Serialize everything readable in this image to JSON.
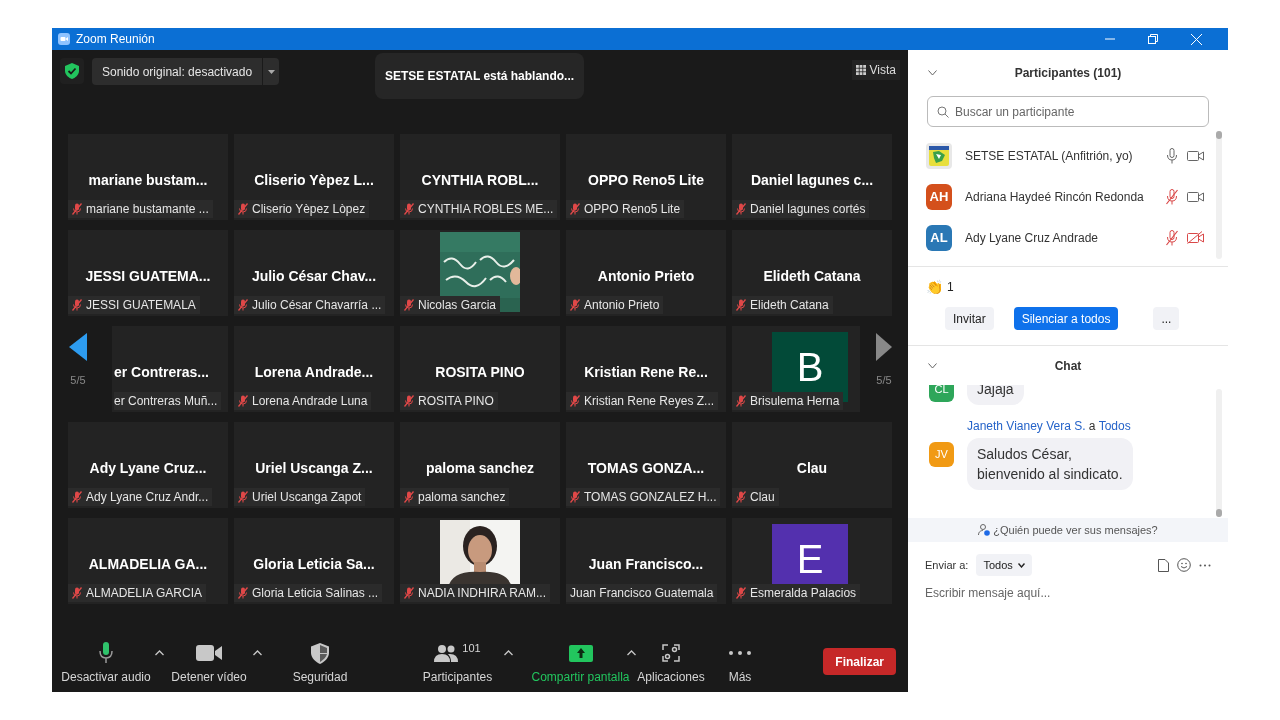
{
  "window": {
    "title": "Zoom Reunión"
  },
  "top_bar": {
    "audio_button": "Sonido original: desactivado",
    "speaking_toast": "SETSE ESTATAL está hablando...",
    "view_button": "Vista"
  },
  "gallery": {
    "page_left": "5/5",
    "page_right": "5/5",
    "tiles": [
      {
        "kind": "name",
        "title": "mariane  bustam...",
        "label": "mariane bustamante ...",
        "muted": true
      },
      {
        "kind": "name",
        "title": "Cliserio  Yèpez  L...",
        "label": "Cliserio Yèpez Lòpez",
        "muted": true
      },
      {
        "kind": "name",
        "title": "CYNTHIA  ROBL...",
        "label": "CYNTHIA ROBLES ME...",
        "muted": true
      },
      {
        "kind": "name",
        "title": "OPPO Reno5 Lite",
        "label": "OPPO Reno5 Lite",
        "muted": true
      },
      {
        "kind": "name",
        "title": "Daniel  lagunes  c...",
        "label": "Daniel lagunes cortés",
        "muted": true
      },
      {
        "kind": "name",
        "title": "JESSI  GUATEMA...",
        "label": "JESSI GUATEMALA",
        "muted": true
      },
      {
        "kind": "name",
        "title": "Julio  César  Chav...",
        "label": "Julio César Chavarría ...",
        "muted": true
      },
      {
        "kind": "chalkboard",
        "label": "Nicolas Garcia",
        "muted": true
      },
      {
        "kind": "name",
        "title": "Antonio Prieto",
        "label": "Antonio Prieto",
        "muted": true
      },
      {
        "kind": "name",
        "title": "Elideth Catana",
        "label": "Elideth Catana",
        "muted": true
      },
      {
        "kind": "partial",
        "title": "er  Contreras...",
        "label": "er Contreras Muñ...",
        "muted": false
      },
      {
        "kind": "name",
        "title": "Lorena  Andrade...",
        "label": "Lorena Andrade Luna",
        "muted": true
      },
      {
        "kind": "name",
        "title": "ROSITA PINO",
        "label": "ROSITA PINO",
        "muted": true
      },
      {
        "kind": "name",
        "title": "Kristian  Rene  Re...",
        "label": "Kristian Rene Reyes Z...",
        "muted": true
      },
      {
        "kind": "avatar",
        "letter": "B",
        "color": "#024a38",
        "label": "Brisulema Herna",
        "muted": true
      },
      {
        "kind": "name",
        "title": "Ady  Lyane  Cruz...",
        "label": "Ady Lyane Cruz Andr...",
        "muted": true
      },
      {
        "kind": "name",
        "title": "Uriel  Uscanga  Z...",
        "label": "Uriel Uscanga Zapot",
        "muted": true
      },
      {
        "kind": "name",
        "title": "paloma sanchez",
        "label": "paloma sanchez",
        "muted": true
      },
      {
        "kind": "name",
        "title": "TOMAS  GONZA...",
        "label": "TOMAS GONZALEZ H...",
        "muted": true
      },
      {
        "kind": "name",
        "title": "Clau",
        "label": "Clau",
        "muted": true
      },
      {
        "kind": "name",
        "title": "ALMADELIA  GA...",
        "label": "ALMADELIA GARCIA",
        "muted": true
      },
      {
        "kind": "name",
        "title": "Gloria  Leticia  Sa...",
        "label": "Gloria Leticia Salinas ...",
        "muted": true
      },
      {
        "kind": "selfie",
        "label": "NADIA INDHIRA RAM...",
        "muted": true
      },
      {
        "kind": "name",
        "title": "Juan  Francisco...",
        "label": "Juan Francisco Guatemala",
        "muted": false
      },
      {
        "kind": "avatar",
        "letter": "E",
        "color": "#5330ae",
        "label": "Esmeralda Palacios",
        "muted": true
      }
    ]
  },
  "toolbar": {
    "items": [
      {
        "kind": "mic",
        "label": "Desactivar audio",
        "caret": true
      },
      {
        "kind": "video",
        "label": "Detener vídeo",
        "caret": true
      },
      {
        "kind": "security",
        "label": "Seguridad",
        "caret": false
      },
      {
        "kind": "participants",
        "label": "Participantes",
        "count": "101",
        "caret": true
      },
      {
        "kind": "share",
        "label": "Compartir pantalla",
        "caret": true
      },
      {
        "kind": "apps",
        "label": "Aplicaciones",
        "caret": false
      },
      {
        "kind": "more",
        "label": "Más",
        "caret": false
      }
    ],
    "end_button": "Finalizar"
  },
  "participants": {
    "title": "Participantes (101)",
    "search_placeholder": "Buscar un participante",
    "list": [
      {
        "kind": "logo",
        "name": "SETSE ESTATAL (Anfitrión, yo)",
        "mic_muted": false,
        "video_off": false
      },
      {
        "kind": "initials",
        "initials": "AH",
        "color": "#d4501c",
        "name": "Adriana Haydeé Rincón Redonda",
        "mic_muted": true,
        "video_off": false
      },
      {
        "kind": "initials",
        "initials": "AL",
        "color": "#2a78b5",
        "name": "Ady Lyane Cruz Andrade",
        "mic_muted": true,
        "video_off": true
      }
    ],
    "reaction": {
      "emoji": "👏",
      "count": "1"
    },
    "buttons": [
      "Invitar",
      "Silenciar a todos",
      "..."
    ]
  },
  "chat": {
    "title": "Chat",
    "messages": [
      {
        "initials": "CL",
        "color": "#2ea65a",
        "text": "Jajaja"
      },
      {
        "initials": "JV",
        "color": "#f19a14",
        "sender": "Janeth Vianey Vera S.",
        "connector": "a",
        "recipient": "Todos",
        "text": "Saludos César,\nbienvenido al sindicato."
      }
    ],
    "notice": "¿Quién puede ver sus mensajes?",
    "send_to_label": "Enviar a:",
    "send_to": "Todos",
    "placeholder": "Escribir mensaje aquí..."
  }
}
